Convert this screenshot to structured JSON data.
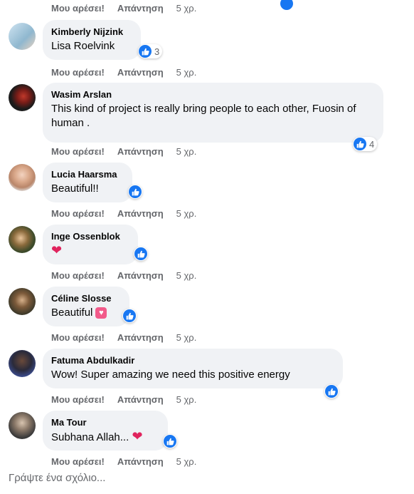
{
  "labels": {
    "like": "Μου αρέσει!",
    "reply": "Απάντηση",
    "time": "5 χρ."
  },
  "comments": [
    {
      "name": "Kimberly Nijzink",
      "text": "Lisa Roelvink",
      "likes": "3"
    },
    {
      "name": "Wasim Arslan",
      "text": "This kind of project is really bring people to each other, Fuosin of human .",
      "likes": "4"
    },
    {
      "name": "Lucia Haarsma",
      "text": "Beautiful!!",
      "likes": ""
    },
    {
      "name": "Inge Ossenblok",
      "text": "",
      "emoji": "heart",
      "likes": ""
    },
    {
      "name": "Céline Slosse",
      "text": "Beautiful",
      "emoji": "pink-heart",
      "likes": ""
    },
    {
      "name": "Fatuma Abdulkadir",
      "text": "Wow! Super amazing we need this positive energy",
      "likes": ""
    },
    {
      "name": "Ma Tour",
      "text": "Subhana Allah...",
      "emoji": "heart",
      "likes": ""
    }
  ],
  "composer": {
    "placeholder": "Γράψτε ένα σχόλιο..."
  },
  "colors": {
    "like_blue": "#1877f2",
    "bubble": "#f0f2f5",
    "meta_gray": "#65676b",
    "heart": "#e0245e"
  }
}
